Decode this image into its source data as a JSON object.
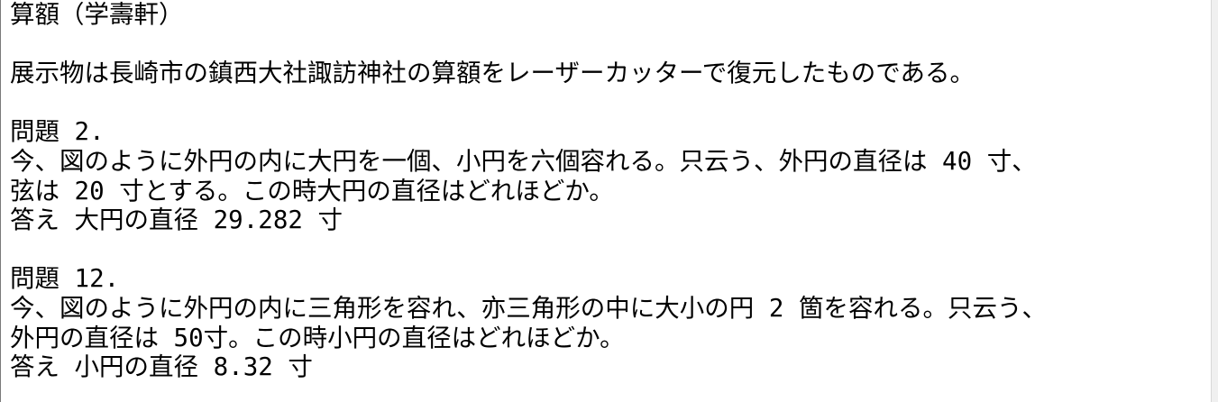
{
  "document": {
    "lines": [
      "算額（学壽軒）",
      "",
      "展示物は長崎市の鎮西大社諏訪神社の算額をレーザーカッターで復元したものである。",
      "",
      "問題 2.",
      "今、図のように外円の内に大円を一個、小円を六個容れる。只云う、外円の直径は 40 寸、",
      "弦は 20 寸とする。この時大円の直径はどれほどか。",
      "答え 大円の直径 29.282 寸",
      "",
      "問題 12.",
      "今、図のように外円の内に三角形を容れ、亦三角形の中に大小の円 2 箇を容れる。只云う、",
      "外円の直径は 50寸。この時小円の直径はどれほどか。",
      "答え 小円の直径 8.32 寸"
    ]
  }
}
